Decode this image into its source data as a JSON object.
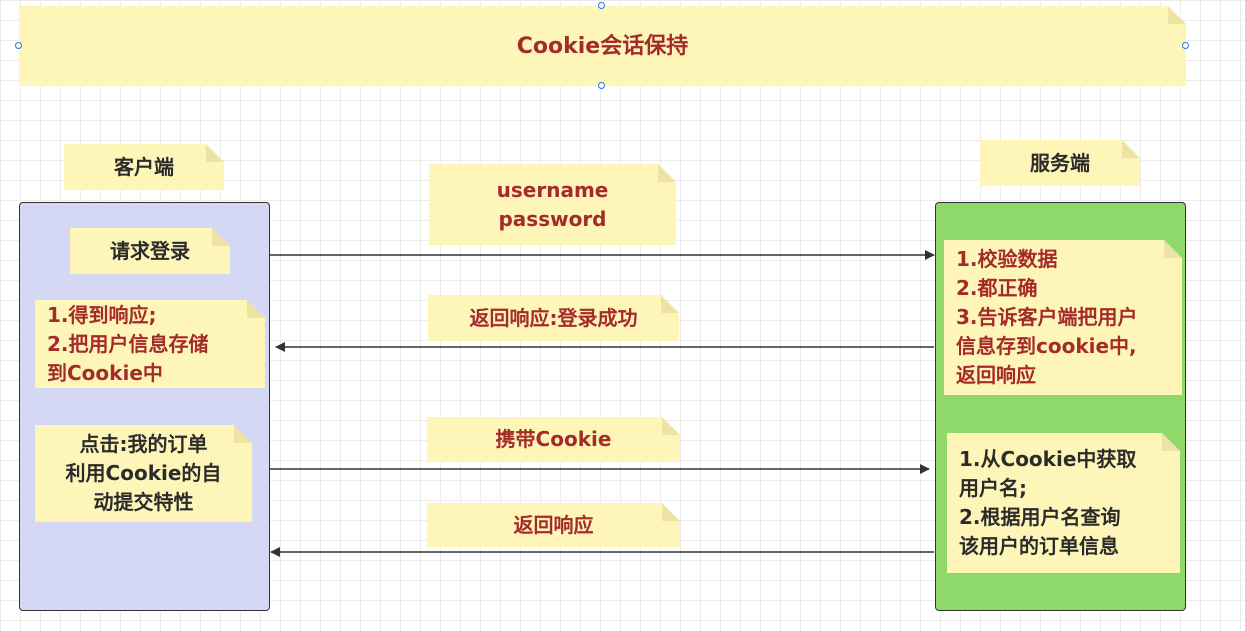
{
  "title": "Cookie会话保持",
  "client_label": "客户端",
  "server_label": "服务端",
  "client_notes": {
    "login": "请求登录",
    "response": "1.得到响应;\n2.把用户信息存储\n到Cookie中",
    "order": "点击:我的订单\n利用Cookie的自\n动提交特性"
  },
  "server_notes": {
    "verify": "1.校验数据\n2.都正确\n3.告诉客户端把用户\n信息存到cookie中,\n返回响应",
    "query": "1.从Cookie中获取\n用户名;\n2.根据用户名查询\n该用户的订单信息"
  },
  "messages": {
    "credentials": "username\npassword",
    "login_success": "返回响应:登录成功",
    "carry_cookie": "携带Cookie",
    "return_response": "返回响应"
  },
  "colors": {
    "note": "#fdf6b8",
    "client_panel": "#d4d8f5",
    "server_panel": "#8fd86a",
    "text_red": "#a52a2a",
    "handle": "#2f74d6"
  }
}
